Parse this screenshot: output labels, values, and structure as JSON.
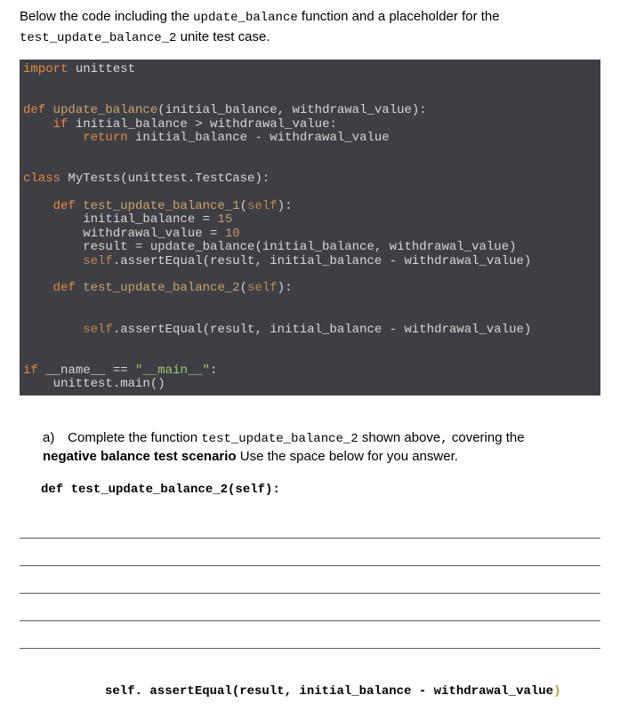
{
  "intro": {
    "pre1": "Below the code including the ",
    "code1": "update_balance",
    "mid1": " function and a placeholder for the ",
    "code2": "test_update_balance_2",
    "post1": " unite test case."
  },
  "code": {
    "l1_kw": "import",
    "l1_rest": " unittest",
    "l3_kw": "def",
    "l3_fn": " update_balance",
    "l3_rest": "(initial_balance, withdrawal_value):",
    "l4_kw": "    if",
    "l4_rest": " initial_balance > withdrawal_value:",
    "l5_kw": "        return",
    "l5_rest": " initial_balance - withdrawal_value",
    "l7_kw": "class",
    "l7_rest": " MyTests(unittest.TestCase):",
    "l9_kw": "    def",
    "l9_fn": " test_update_balance_1",
    "l9_open": "(",
    "l9_self": "self",
    "l9_close": "):",
    "l10": "        initial_balance = ",
    "l10_num": "15",
    "l11": "        withdrawal_value = ",
    "l11_num": "10",
    "l12": "        result = update_balance(initial_balance, withdrawal_value)",
    "l13_self": "        self",
    "l13_rest": ".assertEqual(result, initial_balance - withdrawal_value)",
    "l15_kw": "    def",
    "l15_fn": " test_update_balance_2",
    "l15_open": "(",
    "l15_self": "self",
    "l15_close": "):",
    "l18_self": "        self",
    "l18_rest": ".assertEqual(result, initial_balance - withdrawal_value)",
    "l20_kw": "if",
    "l20_rest": " __name__ == ",
    "l20_str": "\"__main__\"",
    "l20_colon": ":",
    "l21": "    unittest.main()"
  },
  "question": {
    "label": "a)",
    "t1": "Complete the function ",
    "code": "test_update_balance_2",
    "t2": "  shown above",
    "comma": ",",
    "t3": "  covering the ",
    "bold2": "negative balance test scenario ",
    "t4": "Use the space below for you answer."
  },
  "sig": "def test_update_balance_2(self):",
  "final": {
    "text": "self. assertEqual(result, initial_balance - withdrawal_value",
    "paren": ")"
  }
}
